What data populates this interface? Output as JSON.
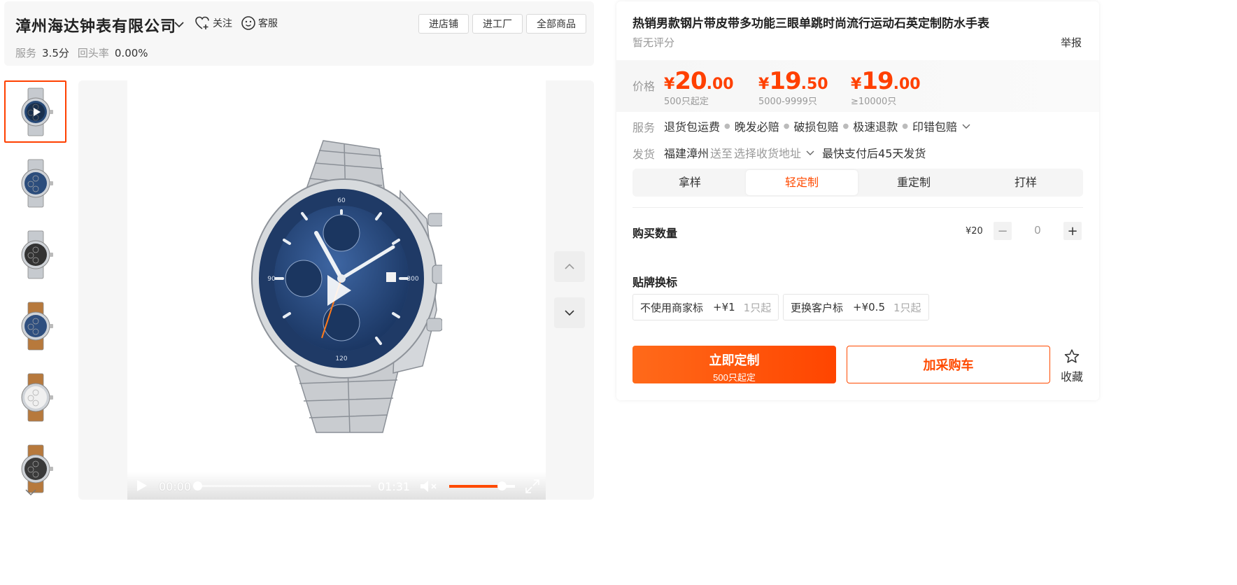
{
  "shop": {
    "name": "漳州海达钟表有限公司",
    "follow_label": "关注",
    "service_label": "客服",
    "buttons": [
      "进店铺",
      "进工厂",
      "全部商品"
    ],
    "service_score_label": "服务",
    "service_score": "3.5分",
    "return_rate_label": "回头率",
    "return_rate": "0.00%"
  },
  "gallery": {
    "thumbnails": [
      {
        "name": "thumb-video",
        "dial": "#274a78",
        "strap": "steel",
        "active": true
      },
      {
        "name": "thumb-blue-steel",
        "dial": "#2c4d7c",
        "strap": "steel"
      },
      {
        "name": "thumb-black-steel",
        "dial": "#333333",
        "strap": "steel"
      },
      {
        "name": "thumb-blue-leather",
        "dial": "#2f4f7f",
        "strap": "leather"
      },
      {
        "name": "thumb-white-leather",
        "dial": "#f0f0f0",
        "strap": "leather"
      },
      {
        "name": "thumb-black-leather",
        "dial": "#3a3a3a",
        "strap": "leather"
      }
    ],
    "video": {
      "current_time": "00:00",
      "duration": "01:31",
      "volume": 0.8,
      "progress": 0.0
    }
  },
  "product": {
    "title": "热销男款钢片带皮带多功能三眼单跳时尚流行运动石英定制防水手表",
    "rating": "暂无评分",
    "report_label": "举报",
    "price_label": "价格",
    "prices": [
      {
        "currency": "¥",
        "int": "20",
        "dec": ".00",
        "qty": "500只起定"
      },
      {
        "currency": "¥",
        "int": "19",
        "dec": ".50",
        "qty": "5000-9999只"
      },
      {
        "currency": "¥",
        "int": "19",
        "dec": ".00",
        "qty": "≥10000只"
      }
    ],
    "service_label": "服务",
    "services": [
      "退货包运费",
      "晚发必赔",
      "破损包赔",
      "极速退款",
      "印错包赔"
    ],
    "ship_label": "发货",
    "ship_origin": "福建漳州",
    "ship_to": "送至",
    "ship_address": "选择收货地址",
    "ship_time": "最快支付后45天发货",
    "tabs": [
      "拿样",
      "轻定制",
      "重定制",
      "打样"
    ],
    "active_tab": 1,
    "quantity_label": "购买数量",
    "unit_price": "¥20",
    "quantity": "0",
    "brand_label": "贴牌换标",
    "brand_options": [
      {
        "name": "不使用商家标",
        "add": "+¥1",
        "min": "1只起"
      },
      {
        "name": "更换客户标",
        "add": "+¥0.5",
        "min": "1只起"
      }
    ],
    "buy_label": "立即定制",
    "buy_sub": "500只起定",
    "cart_label": "加采购车",
    "fav_label": "收藏",
    "accent_color": "#ff4a00"
  }
}
